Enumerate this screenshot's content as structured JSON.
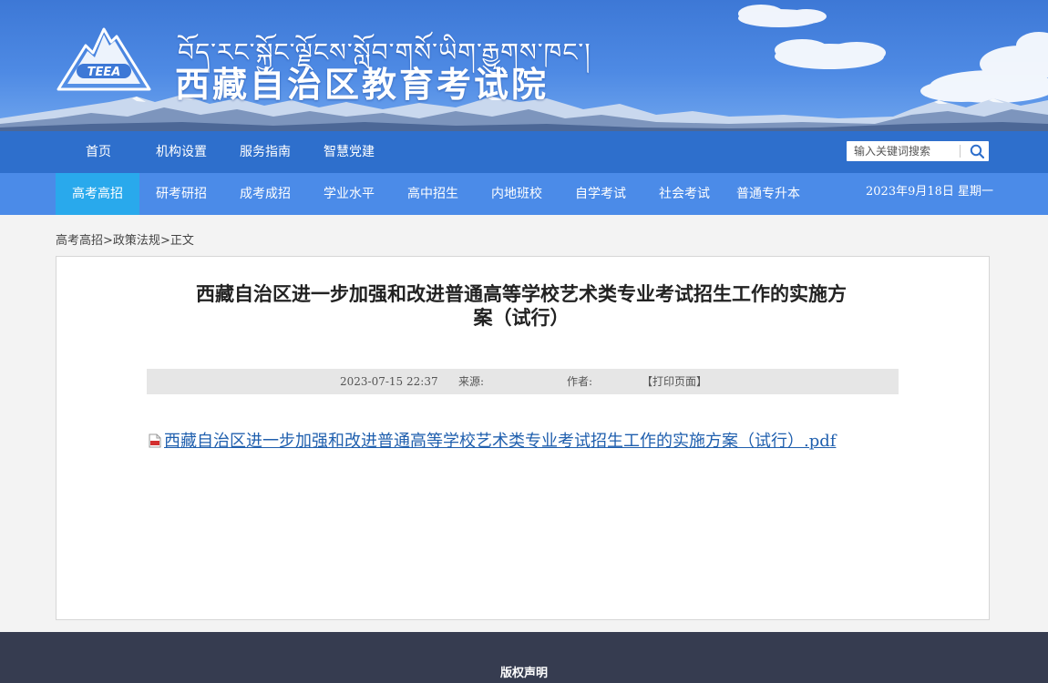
{
  "header": {
    "tibetan_title": "བོད་རང་སྐྱོང་ལྗོངས་སློབ་གསོ་ཡིག་རྒྱུགས་ཁང་།",
    "site_title": "西藏自治区教育考试院",
    "logo_text": "TEEA"
  },
  "nav_primary": {
    "items": [
      {
        "label": "首页"
      },
      {
        "label": "机构设置"
      },
      {
        "label": "服务指南"
      },
      {
        "label": "智慧党建"
      }
    ]
  },
  "search": {
    "placeholder": "输入关键词搜索"
  },
  "nav_secondary": {
    "items": [
      {
        "label": "高考高招",
        "active": true
      },
      {
        "label": "研考研招"
      },
      {
        "label": "成考成招"
      },
      {
        "label": "学业水平"
      },
      {
        "label": "高中招生"
      },
      {
        "label": "内地班校"
      },
      {
        "label": "自学考试"
      },
      {
        "label": "社会考试"
      },
      {
        "label": "普通专升本"
      }
    ],
    "date": "2023年9月18日 星期一"
  },
  "breadcrumb": {
    "level1": "高考高招",
    "sep": ">",
    "level2": "政策法规",
    "level3": "正文"
  },
  "article": {
    "title_line1": "西藏自治区进一步加强和改进普通高等学校艺术类专业考试招生工作的实施方",
    "title_line2": "案（试行）",
    "datetime": "2023-07-15 22:37",
    "source_label": "来源:",
    "author_label": "作者:",
    "print_label": "【打印页面】",
    "attachment": "西藏自治区进一步加强和改进普通高等学校艺术类专业考试招生工作的实施方案（试行）.pdf"
  },
  "footer": {
    "copyright_link": "版权声明"
  },
  "colors": {
    "nav_primary_bg": "#2e6fcc",
    "nav_secondary_bg": "#4b8be8",
    "nav_active_bg": "#29a9ec",
    "footer_bg": "#363c50",
    "link": "#1f5fae"
  }
}
